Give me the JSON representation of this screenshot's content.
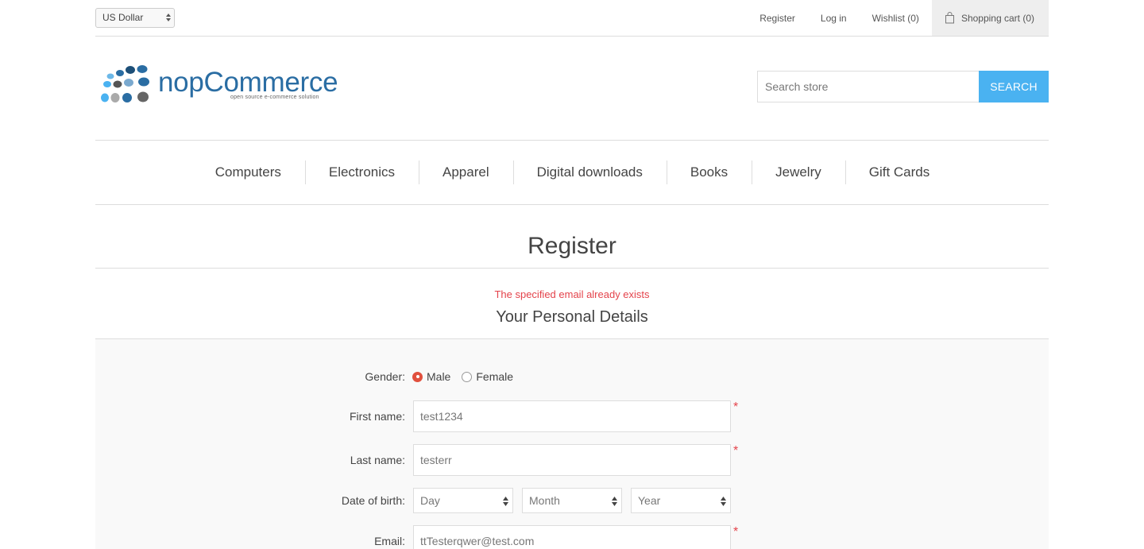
{
  "header": {
    "currency": "US Dollar",
    "links": {
      "register": "Register",
      "login": "Log in",
      "wishlist": "Wishlist (0)",
      "cart": "Shopping cart (0)"
    }
  },
  "logo": {
    "name": "nopCommerce",
    "tagline": "open source e-commerce solution"
  },
  "search": {
    "placeholder": "Search store",
    "button": "Search"
  },
  "menu": [
    "Computers",
    "Electronics",
    "Apparel",
    "Digital downloads",
    "Books",
    "Jewelry",
    "Gift Cards"
  ],
  "page": {
    "title": "Register",
    "error": "The specified email already exists",
    "section_title": "Your Personal Details"
  },
  "form": {
    "gender": {
      "label": "Gender:",
      "male": "Male",
      "female": "Female",
      "selected": "Male"
    },
    "first_name": {
      "label": "First name:",
      "value": "test1234",
      "required": "*"
    },
    "last_name": {
      "label": "Last name:",
      "value": "testerr",
      "required": "*"
    },
    "dob": {
      "label": "Date of birth:",
      "day": "Day",
      "month": "Month",
      "year": "Year"
    },
    "email": {
      "label": "Email:",
      "value": "ttTesterqwer@test.com",
      "required": "*"
    }
  },
  "colors": {
    "accent": "#4ab2f1",
    "error": "#e4434b",
    "radio_selected": "#e1503e",
    "logo_blue": "#2a6da3"
  }
}
